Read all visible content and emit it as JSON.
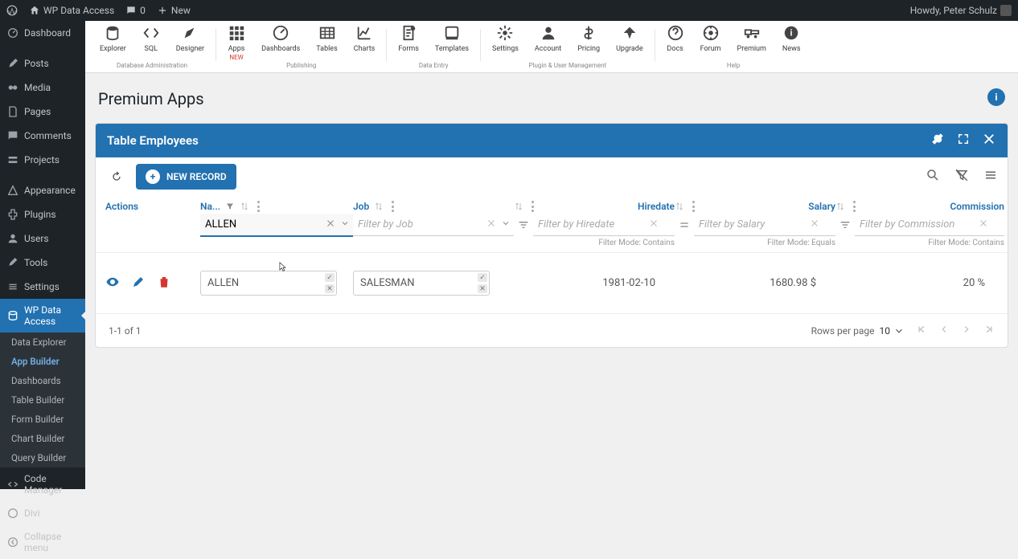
{
  "adminbar": {
    "site": "WP Data Access",
    "comments": "0",
    "new": "New",
    "greeting": "Howdy, Peter Schulz"
  },
  "sidebar": {
    "items": [
      {
        "label": "Dashboard"
      },
      {
        "label": "Posts"
      },
      {
        "label": "Media"
      },
      {
        "label": "Pages"
      },
      {
        "label": "Comments"
      },
      {
        "label": "Projects"
      },
      {
        "label": "Appearance"
      },
      {
        "label": "Plugins"
      },
      {
        "label": "Users"
      },
      {
        "label": "Tools"
      },
      {
        "label": "Settings"
      },
      {
        "label": "WP Data Access"
      },
      {
        "label": "Code Manager"
      },
      {
        "label": "Divi"
      },
      {
        "label": "Collapse menu"
      }
    ],
    "submenu": [
      "Data Explorer",
      "App Builder",
      "Dashboards",
      "Table Builder",
      "Form Builder",
      "Chart Builder",
      "Query Builder"
    ]
  },
  "toolbar": {
    "groups": [
      {
        "caption": "Database Administration",
        "items": [
          {
            "label": "Explorer"
          },
          {
            "label": "SQL"
          },
          {
            "label": "Designer"
          }
        ]
      },
      {
        "caption": "Publishing",
        "items": [
          {
            "label": "Apps",
            "sub": "NEW"
          },
          {
            "label": "Dashboards"
          },
          {
            "label": "Tables"
          },
          {
            "label": "Charts"
          }
        ]
      },
      {
        "caption": "Data Entry",
        "items": [
          {
            "label": "Forms"
          },
          {
            "label": "Templates"
          }
        ]
      },
      {
        "caption": "Plugin & User Management",
        "items": [
          {
            "label": "Settings"
          },
          {
            "label": "Account"
          },
          {
            "label": "Pricing"
          },
          {
            "label": "Upgrade"
          }
        ]
      },
      {
        "caption": "Help",
        "items": [
          {
            "label": "Docs"
          },
          {
            "label": "Forum"
          },
          {
            "label": "Premium"
          },
          {
            "label": "News"
          }
        ]
      }
    ]
  },
  "page": {
    "title": "Premium Apps"
  },
  "card": {
    "title": "Table Employees",
    "new_record": "NEW RECORD",
    "columns": {
      "actions": "Actions",
      "name": "Na...",
      "job": "Job",
      "hiredate": "Hiredate",
      "salary": "Salary",
      "commission": "Commission"
    },
    "filters": {
      "name_value": "ALLEN",
      "job_placeholder": "Filter by Job",
      "hire_placeholder": "Filter by Hiredate",
      "hire_mode": "Filter Mode: Contains",
      "salary_placeholder": "Filter by Salary",
      "salary_mode": "Filter Mode: Equals",
      "comm_placeholder": "Filter by Commission",
      "comm_mode": "Filter Mode: Contains"
    },
    "rows": [
      {
        "name": "ALLEN",
        "job": "SALESMAN",
        "hiredate": "1981-02-10",
        "salary": "1680.98 $",
        "commission": "20 %"
      }
    ],
    "footer": {
      "range": "1-1 of 1",
      "rows_label": "Rows per page",
      "rows_value": "10"
    }
  }
}
